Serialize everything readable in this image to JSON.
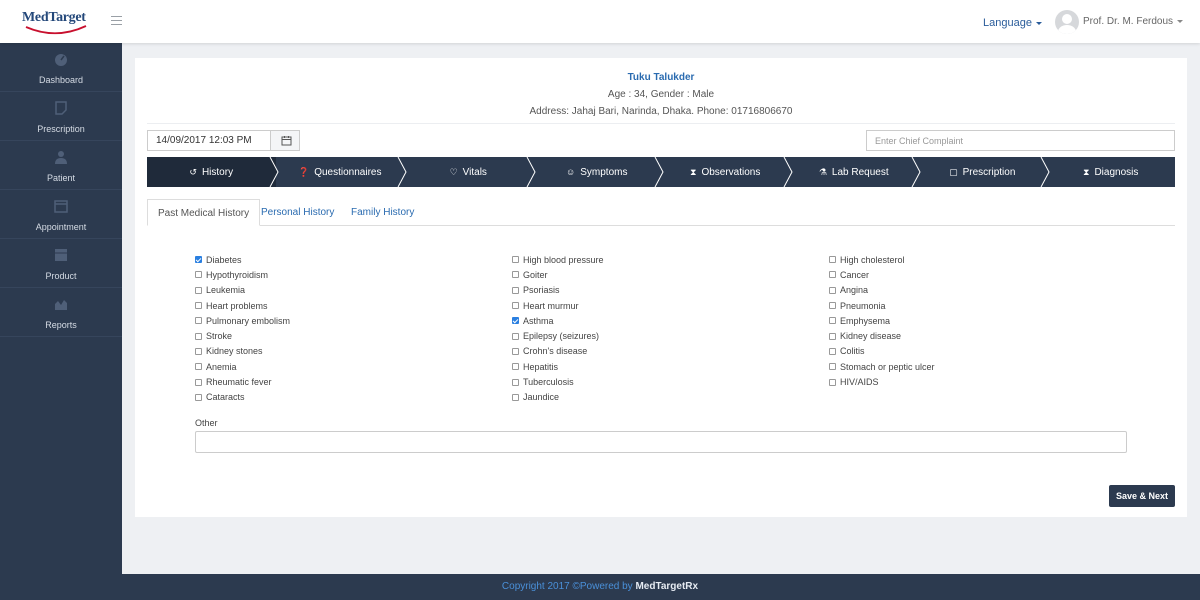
{
  "brand": {
    "logo_text": "MedTarget"
  },
  "header": {
    "language_label": "Language",
    "user_name": "Prof. Dr. M. Ferdous"
  },
  "sidebar": {
    "items": [
      {
        "label": "Dashboard",
        "icon": "dashboard-icon"
      },
      {
        "label": "Prescription",
        "icon": "prescription-icon"
      },
      {
        "label": "Patient",
        "icon": "patient-icon"
      },
      {
        "label": "Appointment",
        "icon": "calendar-icon"
      },
      {
        "label": "Product",
        "icon": "product-icon"
      },
      {
        "label": "Reports",
        "icon": "chart-icon"
      }
    ]
  },
  "patient": {
    "name": "Tuku Talukder",
    "meta": "Age : 34, Gender : Male",
    "address": "Address: Jahaj Bari, Narinda, Dhaka. Phone: 01716806670"
  },
  "form": {
    "datetime_value": "14/09/2017 12:03 PM",
    "chief_complaint_placeholder": "Enter Chief Complaint",
    "other_label": "Other",
    "other_value": "",
    "save_label": "Save & Next"
  },
  "steps": [
    {
      "label": "History",
      "icon": "history-icon",
      "glyph": "↺",
      "active": true
    },
    {
      "label": "Questionnaires",
      "icon": "question-icon",
      "glyph": "❓",
      "active": false
    },
    {
      "label": "Vitals",
      "icon": "stethoscope-icon",
      "glyph": "♡",
      "active": false
    },
    {
      "label": "Symptoms",
      "icon": "symptoms-icon",
      "glyph": "☺",
      "active": false
    },
    {
      "label": "Observations",
      "icon": "hourglass-icon",
      "glyph": "⧗",
      "active": false
    },
    {
      "label": "Lab Request",
      "icon": "flask-icon",
      "glyph": "⚗",
      "active": false
    },
    {
      "label": "Prescription",
      "icon": "note-icon",
      "glyph": "▢",
      "active": false
    },
    {
      "label": "Diagnosis",
      "icon": "hourglass-icon",
      "glyph": "⧗",
      "active": false
    }
  ],
  "tabs": [
    {
      "label": "Past Medical History",
      "active": true
    },
    {
      "label": "Personal History",
      "active": false
    },
    {
      "label": "Family History",
      "active": false
    }
  ],
  "conditions": {
    "col1": [
      {
        "label": "Diabetes",
        "checked": true
      },
      {
        "label": "Hypothyroidism",
        "checked": false
      },
      {
        "label": "Leukemia",
        "checked": false
      },
      {
        "label": "Heart problems",
        "checked": false
      },
      {
        "label": "Pulmonary embolism",
        "checked": false
      },
      {
        "label": "Stroke",
        "checked": false
      },
      {
        "label": "Kidney stones",
        "checked": false
      },
      {
        "label": "Anemia",
        "checked": false
      },
      {
        "label": "Rheumatic fever",
        "checked": false
      },
      {
        "label": "Cataracts",
        "checked": false
      }
    ],
    "col2": [
      {
        "label": "High blood pressure",
        "checked": false
      },
      {
        "label": "Goiter",
        "checked": false
      },
      {
        "label": "Psoriasis",
        "checked": false
      },
      {
        "label": "Heart murmur",
        "checked": false
      },
      {
        "label": "Asthma",
        "checked": true
      },
      {
        "label": "Epilepsy (seizures)",
        "checked": false
      },
      {
        "label": "Crohn's disease",
        "checked": false
      },
      {
        "label": "Hepatitis",
        "checked": false
      },
      {
        "label": "Tuberculosis",
        "checked": false
      },
      {
        "label": "Jaundice",
        "checked": false
      }
    ],
    "col3": [
      {
        "label": "High cholesterol",
        "checked": false
      },
      {
        "label": "Cancer",
        "checked": false
      },
      {
        "label": "Angina",
        "checked": false
      },
      {
        "label": "Pneumonia",
        "checked": false
      },
      {
        "label": "Emphysema",
        "checked": false
      },
      {
        "label": "Kidney disease",
        "checked": false
      },
      {
        "label": "Colitis",
        "checked": false
      },
      {
        "label": "Stomach or peptic ulcer",
        "checked": false
      },
      {
        "label": "HIV/AIDS",
        "checked": false
      }
    ]
  },
  "footer": {
    "prefix": "Copyright 2017 ©Powered by",
    "brand": "MedTargetRx"
  },
  "colors": {
    "sidebar_bg": "#2c3a4f",
    "accent_blue": "#2a6bb0",
    "checkbox_checked": "#2a7fe0"
  }
}
